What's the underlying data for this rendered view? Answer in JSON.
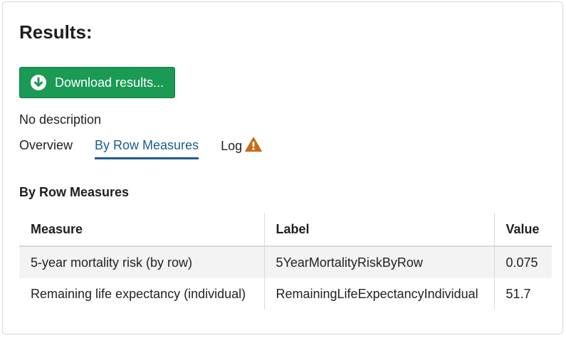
{
  "header": {
    "title": "Results:"
  },
  "download": {
    "label": "Download results..."
  },
  "description": "No description",
  "tabs": [
    {
      "label": "Overview",
      "active": false
    },
    {
      "label": "By Row Measures",
      "active": true
    },
    {
      "label": "Log",
      "active": false,
      "icon": "warning-icon"
    }
  ],
  "section": {
    "title": "By Row Measures"
  },
  "table": {
    "headers": [
      "Measure",
      "Label",
      "Value"
    ],
    "rows": [
      [
        "5-year mortality risk (by row)",
        "5YearMortalityRiskByRow",
        "0.075"
      ],
      [
        "Remaining life expectancy (individual)",
        "RemainingLifeExpectancyIndividual",
        "51.7"
      ]
    ]
  },
  "colors": {
    "accent": "#1d5c8f",
    "button": "#1a9a53",
    "warning": "#c96a17"
  }
}
